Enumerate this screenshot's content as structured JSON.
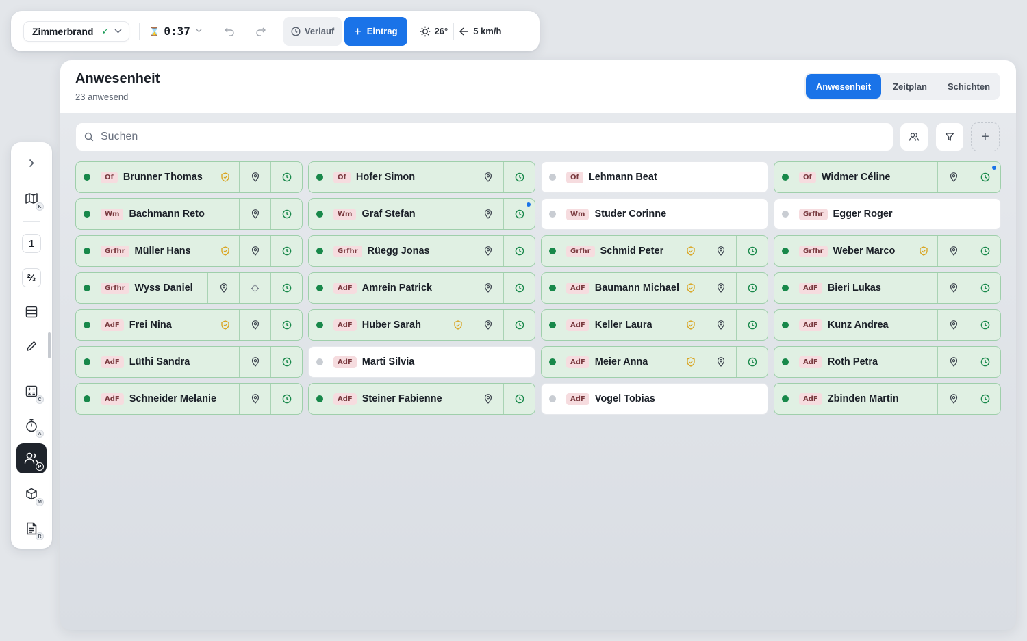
{
  "topbar": {
    "incident_name": "Zimmerbrand",
    "timer": "0:37",
    "history_label": "Verlauf",
    "add_entry_label": "Eintrag",
    "temperature": "26°",
    "wind": "5 km/h"
  },
  "sidebar": {
    "items": [
      {
        "name": "expand",
        "icon": "chevron-right-icon"
      },
      {
        "name": "map",
        "icon": "map-icon",
        "sub": "K"
      },
      {
        "name": "one",
        "icon": "number-one-icon",
        "text": "1"
      },
      {
        "name": "two-thirds",
        "icon": "fraction-icon",
        "text": "⅔"
      },
      {
        "name": "list",
        "icon": "table-icon"
      },
      {
        "name": "edit",
        "icon": "pencil-icon"
      },
      {
        "name": "calc",
        "icon": "calculator-icon",
        "sub": "C"
      },
      {
        "name": "timer",
        "icon": "stopwatch-icon",
        "sub": "A"
      },
      {
        "name": "people",
        "icon": "people-icon",
        "sub": "P",
        "active": true
      },
      {
        "name": "material",
        "icon": "cube-icon",
        "sub": "M"
      },
      {
        "name": "report",
        "icon": "document-icon",
        "sub": "R"
      }
    ]
  },
  "panel": {
    "title": "Anwesenheit",
    "subtitle": "23 anwesend",
    "tabs": [
      {
        "label": "Anwesenheit",
        "active": true
      },
      {
        "label": "Zeitplan",
        "active": false
      },
      {
        "label": "Schichten",
        "active": false
      }
    ],
    "search_placeholder": "Suchen"
  },
  "colors": {
    "accent": "#1a73e8",
    "present_bg": "#e0f0e3",
    "present_dot": "#18884a",
    "absent_dot": "#c9cdd3",
    "role_bg": "#f6dcdf",
    "badge": "#d9a21b"
  },
  "roster": [
    {
      "role": "Of",
      "name": "Brunner Thomas",
      "present": true,
      "badge": true
    },
    {
      "role": "Of",
      "name": "Hofer Simon",
      "present": true
    },
    {
      "role": "Of",
      "name": "Lehmann Beat",
      "present": false
    },
    {
      "role": "Of",
      "name": "Widmer Céline",
      "present": true,
      "notify": true
    },
    {
      "role": "Wm",
      "name": "Bachmann Reto",
      "present": true
    },
    {
      "role": "Wm",
      "name": "Graf Stefan",
      "present": true,
      "notify": true
    },
    {
      "role": "Wm",
      "name": "Studer Corinne",
      "present": false
    },
    {
      "role": "Grfhr",
      "name": "Egger Roger",
      "present": false
    },
    {
      "role": "Grfhr",
      "name": "Müller Hans",
      "present": true,
      "badge": true
    },
    {
      "role": "Grfhr",
      "name": "Rüegg Jonas",
      "present": true
    },
    {
      "role": "Grfhr",
      "name": "Schmid Peter",
      "present": true,
      "badge": true
    },
    {
      "role": "Grfhr",
      "name": "Weber Marco",
      "present": true,
      "badge": true
    },
    {
      "role": "Grfhr",
      "name": "Wyss Daniel",
      "present": true,
      "crosshair": true
    },
    {
      "role": "AdF",
      "name": "Amrein Patrick",
      "present": true
    },
    {
      "role": "AdF",
      "name": "Baumann Michael",
      "present": true,
      "badge": true
    },
    {
      "role": "AdF",
      "name": "Bieri Lukas",
      "present": true
    },
    {
      "role": "AdF",
      "name": "Frei Nina",
      "present": true,
      "badge": true
    },
    {
      "role": "AdF",
      "name": "Huber Sarah",
      "present": true,
      "badge": true
    },
    {
      "role": "AdF",
      "name": "Keller Laura",
      "present": true,
      "badge": true
    },
    {
      "role": "AdF",
      "name": "Kunz Andrea",
      "present": true
    },
    {
      "role": "AdF",
      "name": "Lüthi Sandra",
      "present": true
    },
    {
      "role": "AdF",
      "name": "Marti Silvia",
      "present": false
    },
    {
      "role": "AdF",
      "name": "Meier Anna",
      "present": true,
      "badge": true
    },
    {
      "role": "AdF",
      "name": "Roth Petra",
      "present": true
    },
    {
      "role": "AdF",
      "name": "Schneider Melanie",
      "present": true
    },
    {
      "role": "AdF",
      "name": "Steiner Fabienne",
      "present": true
    },
    {
      "role": "AdF",
      "name": "Vogel Tobias",
      "present": false
    },
    {
      "role": "AdF",
      "name": "Zbinden Martin",
      "present": true
    }
  ]
}
